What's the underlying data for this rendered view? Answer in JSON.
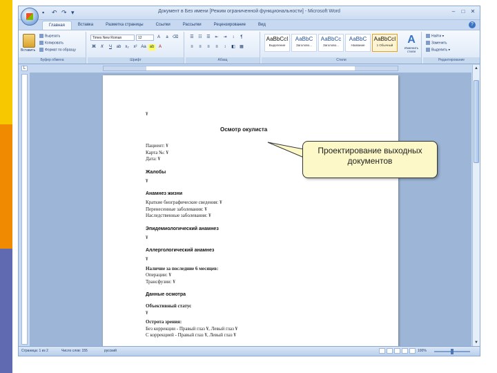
{
  "window": {
    "title": "Документ в Без имени [Режим ограниченной функциональности] - Microsoft Word",
    "controls": [
      "minimize",
      "maximize",
      "close"
    ]
  },
  "tabs": [
    {
      "label": "Главная",
      "active": true
    },
    {
      "label": "Вставка",
      "active": false
    },
    {
      "label": "Разметка страницы",
      "active": false
    },
    {
      "label": "Ссылки",
      "active": false
    },
    {
      "label": "Рассылки",
      "active": false
    },
    {
      "label": "Рецензирование",
      "active": false
    },
    {
      "label": "Вид",
      "active": false
    }
  ],
  "ribbon": {
    "clipboard": {
      "paste_label": "Вставить",
      "cut_label": "Вырезать",
      "copy_label": "Копировать",
      "format_painter_label": "Формат по образцу",
      "group_label": "Буфер обмена"
    },
    "font": {
      "font_name": "Times New Roman",
      "font_size": "12",
      "group_label": "Шрифт"
    },
    "paragraph": {
      "group_label": "Абзац"
    },
    "styles": {
      "items": [
        {
          "sample": "АаBbCcI",
          "name": "Выделение",
          "blue": false,
          "active": false
        },
        {
          "sample": "АаBbC",
          "name": "Заголово...",
          "blue": true,
          "active": false
        },
        {
          "sample": "АаBbCc",
          "name": "Заголово...",
          "blue": true,
          "active": false
        },
        {
          "sample": "АаBbC",
          "name": "Название",
          "blue": true,
          "active": false
        },
        {
          "sample": "АаBbCcI",
          "name": "1 Обычный",
          "blue": false,
          "active": true
        }
      ],
      "change_styles_label": "Изменить стили",
      "group_label": "Стили"
    },
    "editing": {
      "find_label": "Найти",
      "replace_label": "Заменить",
      "select_label": "Выделить",
      "group_label": "Редактирование"
    }
  },
  "document": {
    "cursor_mark": "¥",
    "title": "Осмотр окулиста",
    "lines": [
      {
        "text": "Пациент: ¥",
        "kind": "text"
      },
      {
        "text": "Карта №: ¥",
        "kind": "text"
      },
      {
        "text": "Дата: ¥",
        "kind": "text"
      },
      {
        "text": "Жалобы",
        "kind": "head"
      },
      {
        "text": "¥",
        "kind": "text"
      },
      {
        "text": "Анамнез жизни",
        "kind": "head"
      },
      {
        "text": "Краткие биографические сведения: ¥",
        "kind": "text"
      },
      {
        "text": "Перенесенные заболевания: ¥",
        "kind": "text"
      },
      {
        "text": "Наследственные заболевания: ¥",
        "kind": "text"
      },
      {
        "text": "Эпидемиологический анамнез",
        "kind": "head"
      },
      {
        "text": "¥",
        "kind": "text"
      },
      {
        "text": "Аллергологический анамнез",
        "kind": "head"
      },
      {
        "text": "¥",
        "kind": "text"
      },
      {
        "text": "Наличие за последние 6 месяцев:",
        "kind": "bold"
      },
      {
        "text": "Операции: ¥",
        "kind": "text"
      },
      {
        "text": "Трансфузии: ¥",
        "kind": "text"
      },
      {
        "text": "Данные осмотра",
        "kind": "head"
      },
      {
        "text": "Объективный статус",
        "kind": "bold"
      },
      {
        "text": "¥",
        "kind": "text"
      },
      {
        "text": "Острота зрения:",
        "kind": "bold"
      },
      {
        "text": "Без коррекции - Правый глаз ¥, Левый глаз ¥",
        "kind": "text"
      },
      {
        "text": "С коррекцией - Правый глаз ¥, Левый глаз ¥",
        "kind": "text"
      }
    ]
  },
  "statusbar": {
    "page": "Страница: 1 из 2",
    "words": "Число слов: 155",
    "language": "русский",
    "zoom": "100%"
  },
  "callout": {
    "text": "Проектирование выходных документов"
  },
  "colors": {
    "accent_yellow": "#f7c800",
    "accent_orange": "#f08a00",
    "accent_purple": "#5f6ab0",
    "callout_fill": "#fcf8c8"
  }
}
